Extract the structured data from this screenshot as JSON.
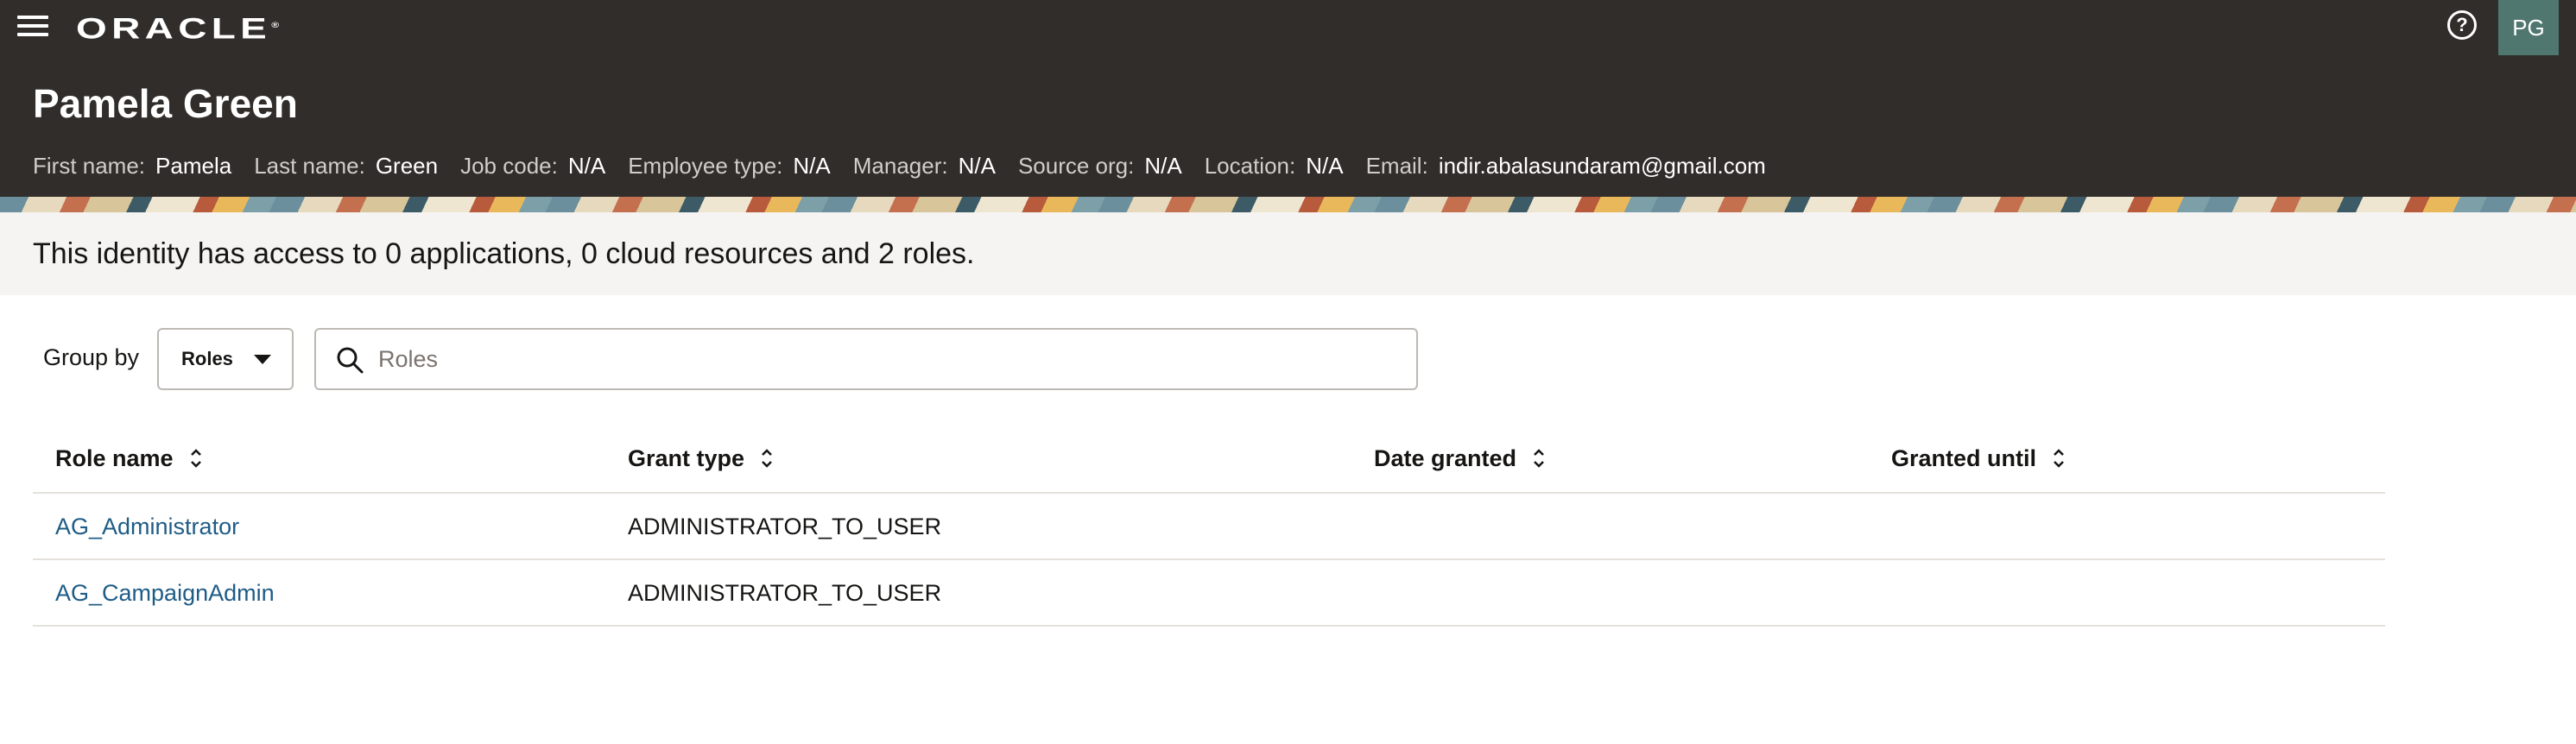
{
  "header": {
    "logo_text": "ORACLE",
    "logo_mark": "®",
    "help_icon": "question-circle-icon",
    "help_glyph": "?",
    "avatar_initials": "PG",
    "menu_icon": "hamburger-menu-icon"
  },
  "identity": {
    "name": "Pamela Green",
    "attributes": [
      {
        "label": "First name:",
        "value": "Pamela"
      },
      {
        "label": "Last name:",
        "value": "Green"
      },
      {
        "label": "Job code:",
        "value": "N/A"
      },
      {
        "label": "Employee type:",
        "value": "N/A"
      },
      {
        "label": "Manager:",
        "value": "N/A"
      },
      {
        "label": "Source org:",
        "value": "N/A"
      },
      {
        "label": "Location:",
        "value": "N/A"
      },
      {
        "label": "Email:",
        "value": "indir.abalasundaram@gmail.com"
      }
    ]
  },
  "summary": {
    "text": "This identity has access to 0 applications, 0 cloud resources and 2 roles."
  },
  "toolbar": {
    "group_by_label": "Group by",
    "group_by_value": "Roles",
    "search_placeholder": "Roles"
  },
  "table": {
    "columns": [
      "Role name",
      "Grant type",
      "Date granted",
      "Granted until"
    ],
    "rows": [
      {
        "role_name": "AG_Administrator",
        "grant_type": "ADMINISTRATOR_TO_USER",
        "date_granted": "",
        "granted_until": ""
      },
      {
        "role_name": "AG_CampaignAdmin",
        "grant_type": "ADMINISTRATOR_TO_USER",
        "date_granted": "",
        "granted_until": ""
      }
    ]
  },
  "colors": {
    "header_bg": "#312d2a",
    "summary_bg": "#f5f4f2",
    "link": "#1e5c86",
    "avatar_bg": "#50776f"
  }
}
